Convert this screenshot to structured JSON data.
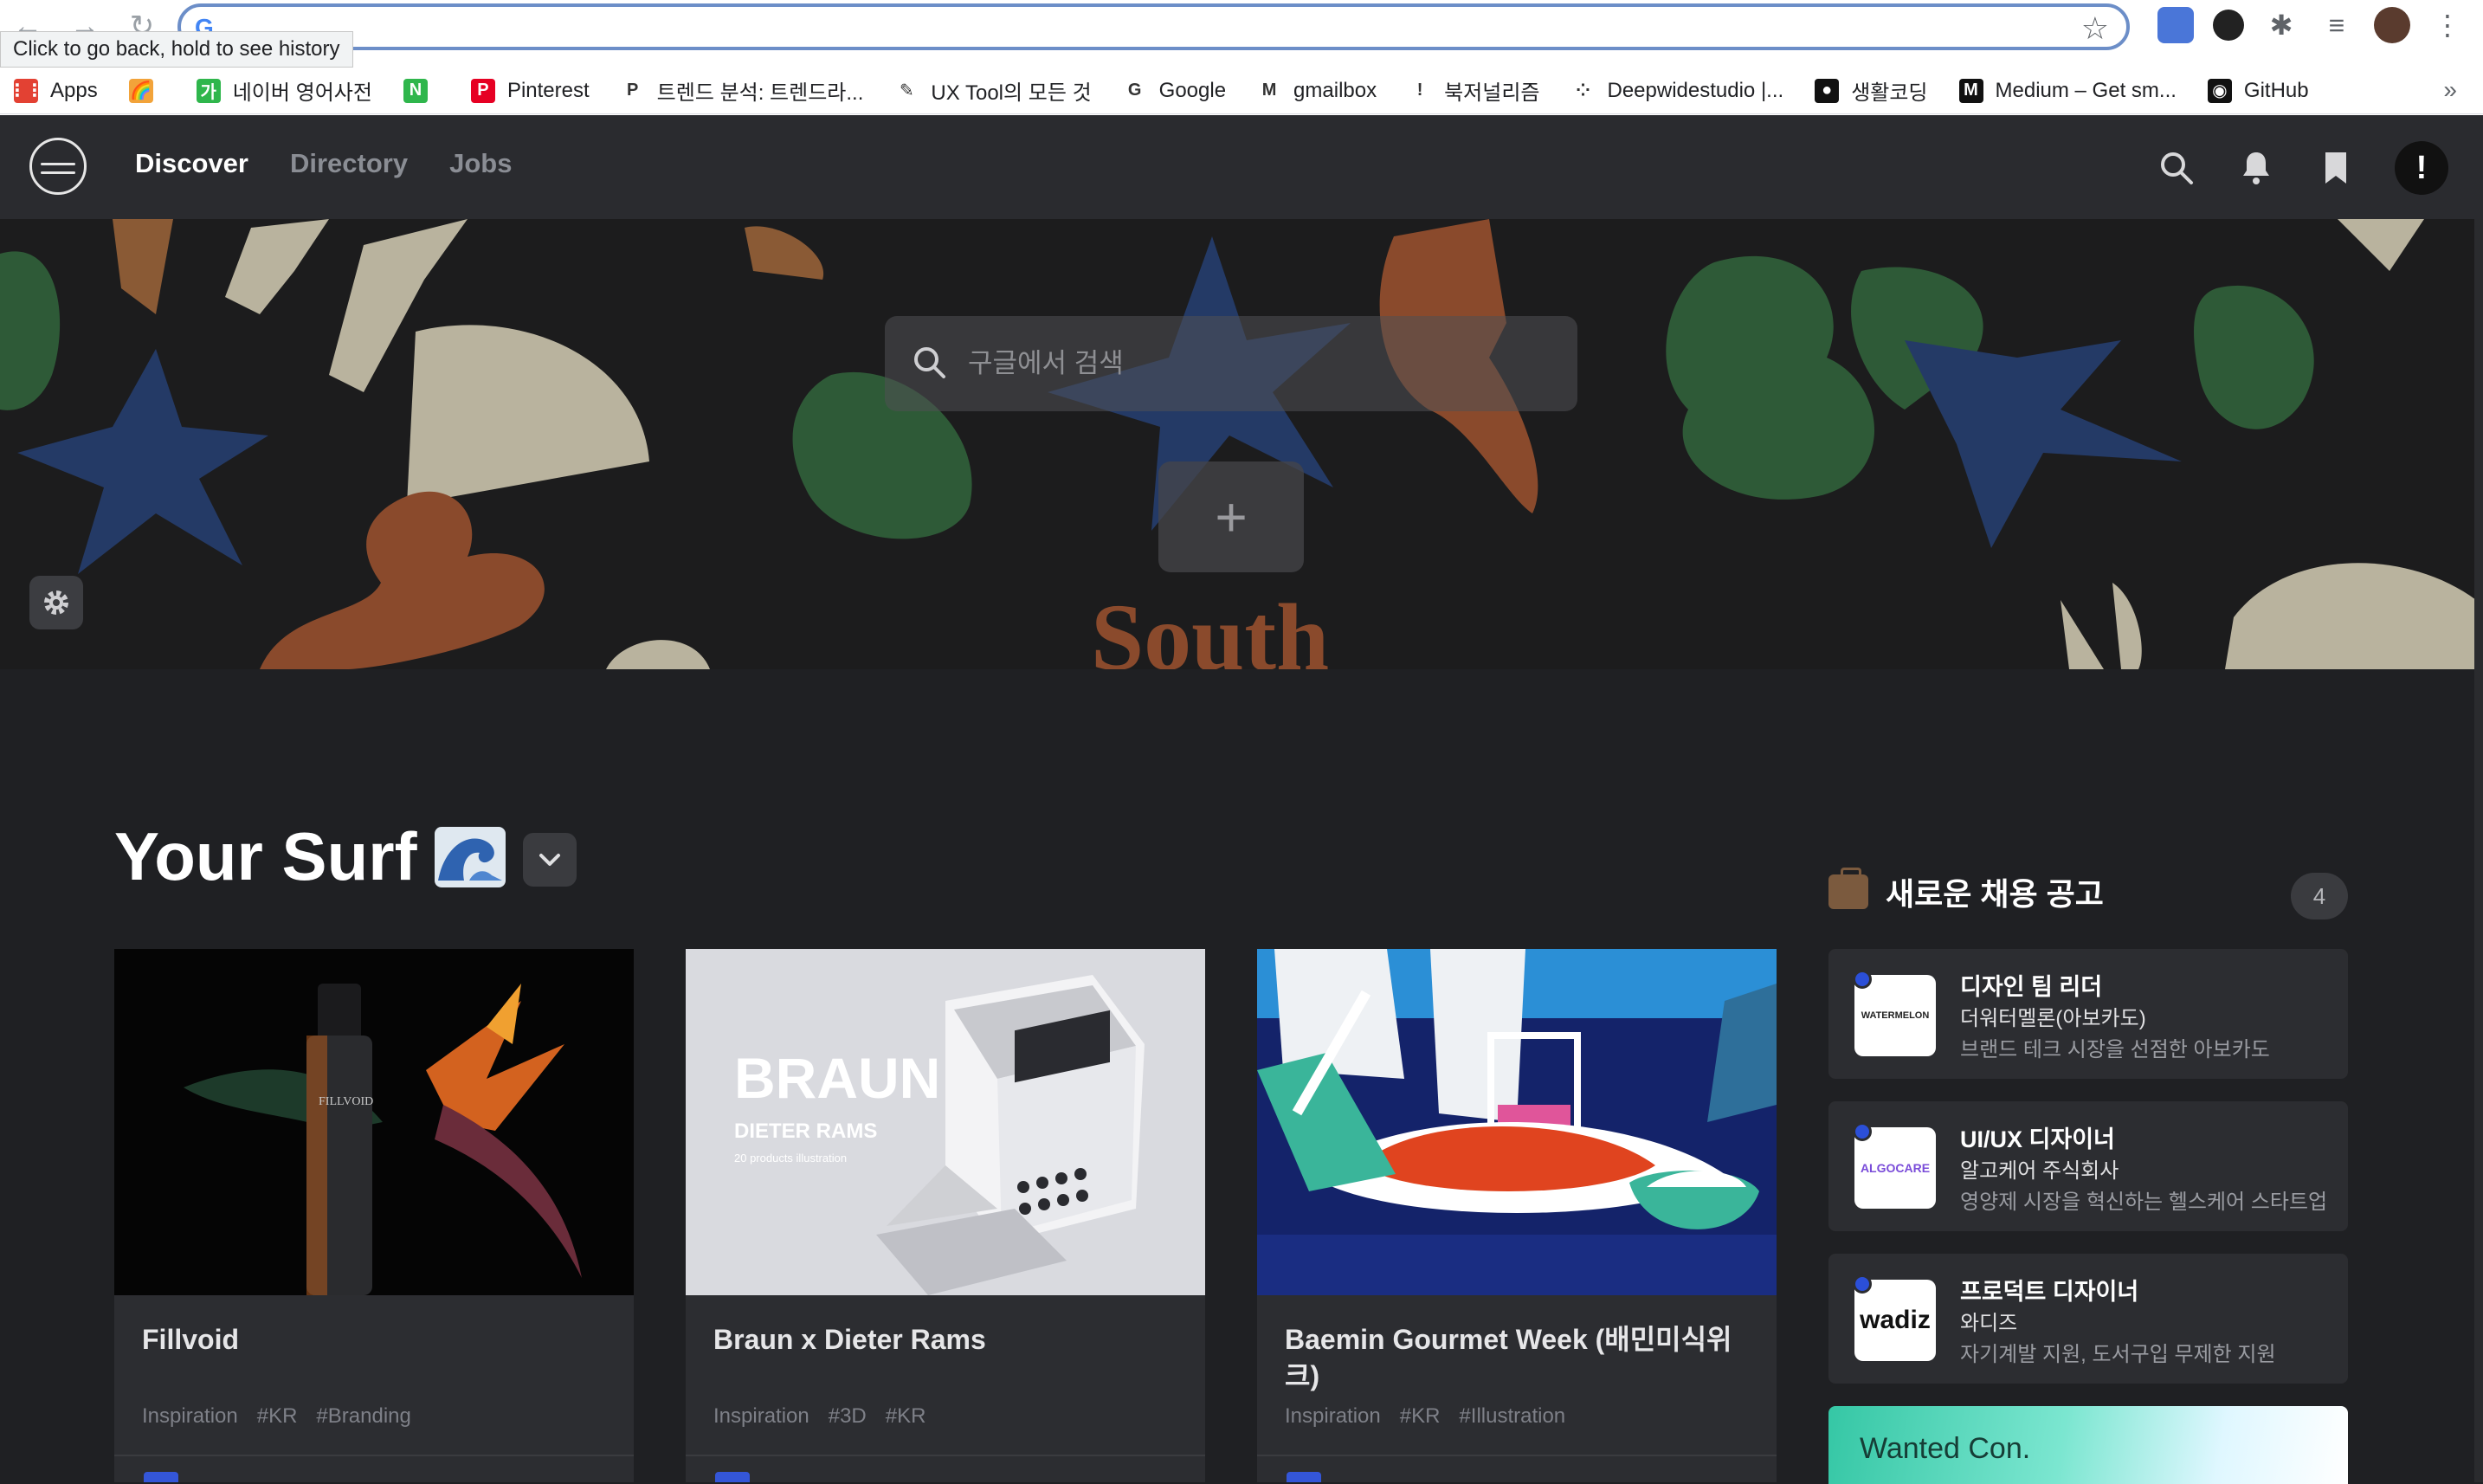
{
  "browser": {
    "tooltip": "Click to go back, hold to see history",
    "omnibox_value": "",
    "bookmarks": [
      {
        "label": "Apps",
        "color": "#e34133",
        "glyph": "⋮⋮"
      },
      {
        "label": "",
        "color": "#f2a33a",
        "glyph": "🌈"
      },
      {
        "label": "네이버 영어사전",
        "color": "#2fb64c",
        "glyph": "가"
      },
      {
        "label": "",
        "color": "#2fb64c",
        "glyph": "N"
      },
      {
        "label": "Pinterest",
        "color": "#e60023",
        "glyph": "P"
      },
      {
        "label": "트렌드 분석: 트렌드라...",
        "color": "#ffffff",
        "glyph": "P"
      },
      {
        "label": "UX Tool의 모든 것",
        "color": "#ffffff",
        "glyph": "✎"
      },
      {
        "label": "Google",
        "color": "#ffffff",
        "glyph": "G"
      },
      {
        "label": "gmailbox",
        "color": "#ffffff",
        "glyph": "M"
      },
      {
        "label": "북저널리즘",
        "color": "#ffffff",
        "glyph": "!"
      },
      {
        "label": "Deepwidestudio |...",
        "color": "#ffffff",
        "glyph": "⁘"
      },
      {
        "label": "생활코딩",
        "color": "#111111",
        "glyph": "●"
      },
      {
        "label": "Medium – Get sm...",
        "color": "#111111",
        "glyph": "M"
      },
      {
        "label": "GitHub",
        "color": "#111111",
        "glyph": "◉"
      }
    ],
    "more": "»"
  },
  "app": {
    "nav": [
      {
        "label": "Discover",
        "active": true
      },
      {
        "label": "Directory",
        "active": false
      },
      {
        "label": "Jobs",
        "active": false
      }
    ],
    "avatar_glyph": "!"
  },
  "hero": {
    "search_placeholder": "구글에서 검색",
    "add_glyph": "+"
  },
  "feed": {
    "title": "Your Surf",
    "cards": [
      {
        "title": "Fillvoid",
        "tags": [
          "Inspiration",
          "#KR",
          "#Branding"
        ],
        "thumb_text": "FILLVOID"
      },
      {
        "title": "Braun x Dieter Rams",
        "tags": [
          "Inspiration",
          "#3D",
          "#KR"
        ],
        "thumb_text": "BRAUN",
        "thumb_sub": "DIETER RAMS",
        "thumb_small": "20 products illustration"
      },
      {
        "title": "Baemin Gourmet Week (배민미식위크)",
        "tags": [
          "Inspiration",
          "#KR",
          "#Illustration"
        ]
      }
    ]
  },
  "jobs": {
    "title": "새로운 채용 공고",
    "count": "4",
    "items": [
      {
        "role": "디자인 팀 리더",
        "company": "더워터멜론(아보카도)",
        "desc": "브랜드 테크 시장을 선점한 아보카도",
        "logo": "WATERMELON",
        "logo_color": "#222222"
      },
      {
        "role": "UI/UX 디자이너",
        "company": "알고케어 주식회사",
        "desc": "영양제 시장을 혁신하는 헬스케어 스타트업",
        "logo": "ALGOCARE",
        "logo_color": "#7a4cd9"
      },
      {
        "role": "프로덕트 디자이너",
        "company": "와디즈",
        "desc": "자기계발 지원, 도서구입 무제한 지원",
        "logo": "wadiz",
        "logo_color": "#111111"
      }
    ],
    "promo": "Wanted Con."
  }
}
